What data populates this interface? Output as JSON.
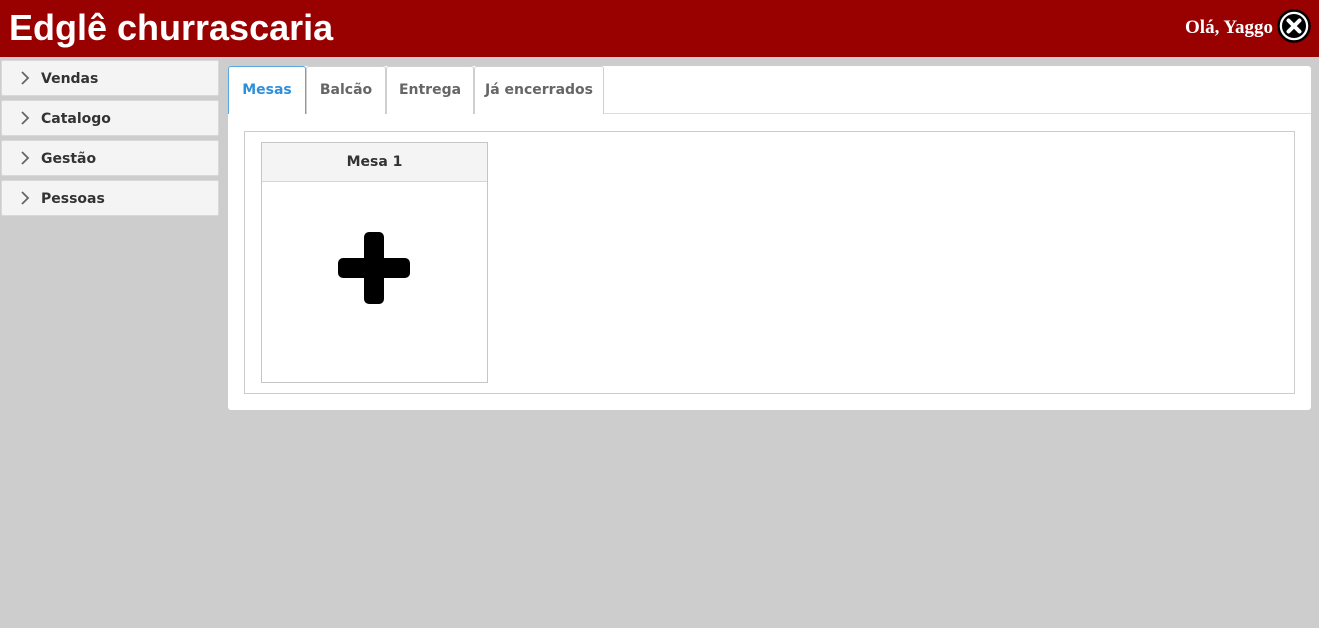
{
  "header": {
    "title": "Edglê churrascaria",
    "greeting": "Olá, Yaggo",
    "logout_icon": "close-circle-icon"
  },
  "sidebar": {
    "items": [
      {
        "label": "Vendas",
        "icon": "chevron-right-icon"
      },
      {
        "label": "Catalogo",
        "icon": "chevron-right-icon"
      },
      {
        "label": "Gestão",
        "icon": "chevron-right-icon"
      },
      {
        "label": "Pessoas",
        "icon": "chevron-right-icon"
      }
    ]
  },
  "tabs": [
    {
      "label": "Mesas",
      "active": true
    },
    {
      "label": "Balcão",
      "active": false
    },
    {
      "label": "Entrega",
      "active": false
    },
    {
      "label": "Já encerrados",
      "active": false
    }
  ],
  "tables": [
    {
      "name": "Mesa 1",
      "action_icon": "plus-icon"
    }
  ],
  "colors": {
    "header_bg": "#990000",
    "page_bg": "#cdcdcd",
    "active_tab": "#2f8fd8"
  }
}
